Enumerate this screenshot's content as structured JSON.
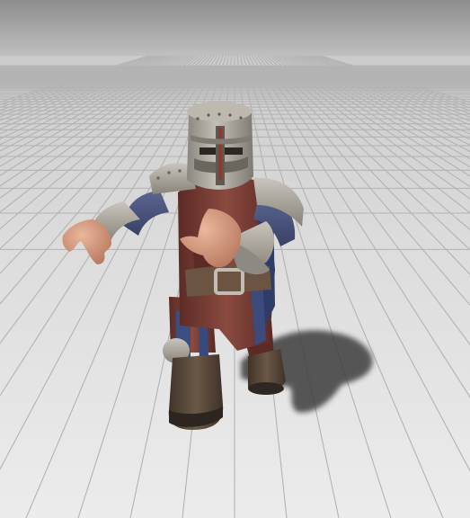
{
  "scene": {
    "colors": {
      "background_top": "#8f8f8f",
      "background_horizon": "#c9c9c9",
      "floor_near": "#e9e9e9",
      "floor_far": "#cfcfcf",
      "grid_line": "#b4b4b4",
      "shadow": "#3a3a3a",
      "armor_steel": "#a7a39a",
      "tunic_red": "#7a3b33",
      "mail_blue": "#4a5578",
      "leather_brown": "#5a4737",
      "skin": "#d9a184"
    }
  }
}
